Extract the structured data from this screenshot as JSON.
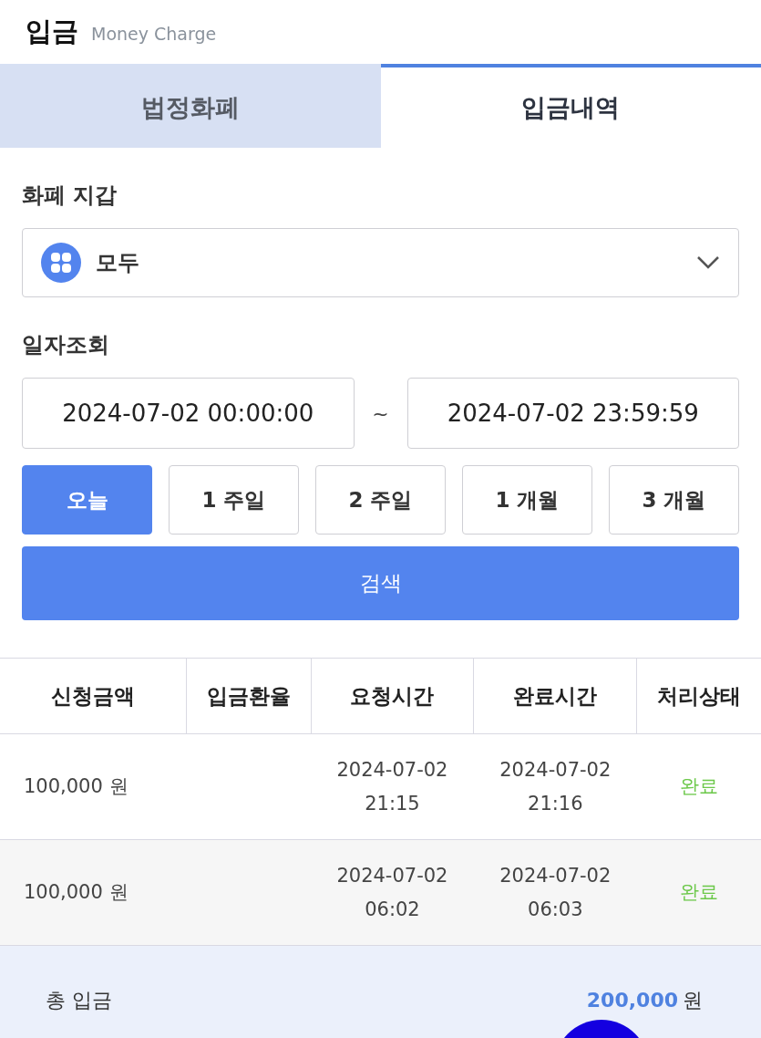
{
  "header": {
    "title": "입금",
    "subtitle": "Money Charge"
  },
  "tabs": [
    {
      "label": "법정화폐",
      "selected": false
    },
    {
      "label": "입금내역",
      "selected": true
    }
  ],
  "wallet": {
    "label": "화폐 지갑",
    "value": "모두"
  },
  "date_query": {
    "label": "일자조회",
    "from": "2024-07-02 00:00:00",
    "separator": "~",
    "to": "2024-07-02 23:59:59"
  },
  "periods": [
    {
      "label": "오늘",
      "selected": true
    },
    {
      "label": "1 주일",
      "selected": false
    },
    {
      "label": "2 주일",
      "selected": false
    },
    {
      "label": "1 개월",
      "selected": false
    },
    {
      "label": "3 개월",
      "selected": false
    }
  ],
  "search_button": "검색",
  "table": {
    "columns": [
      "신청금액",
      "입금환율",
      "요청시간",
      "완료시간",
      "처리상태"
    ],
    "rows": [
      {
        "amount": "100,000 원",
        "request_date": "2024-07-02",
        "request_time": "21:15",
        "complete_date": "2024-07-02",
        "complete_time": "21:16",
        "status": "완료"
      },
      {
        "amount": "100,000 원",
        "request_date": "2024-07-02",
        "request_time": "06:02",
        "complete_date": "2024-07-02",
        "complete_time": "06:03",
        "status": "완료"
      }
    ]
  },
  "total": {
    "label": "총 입금",
    "amount": "200,000",
    "unit": "원"
  }
}
